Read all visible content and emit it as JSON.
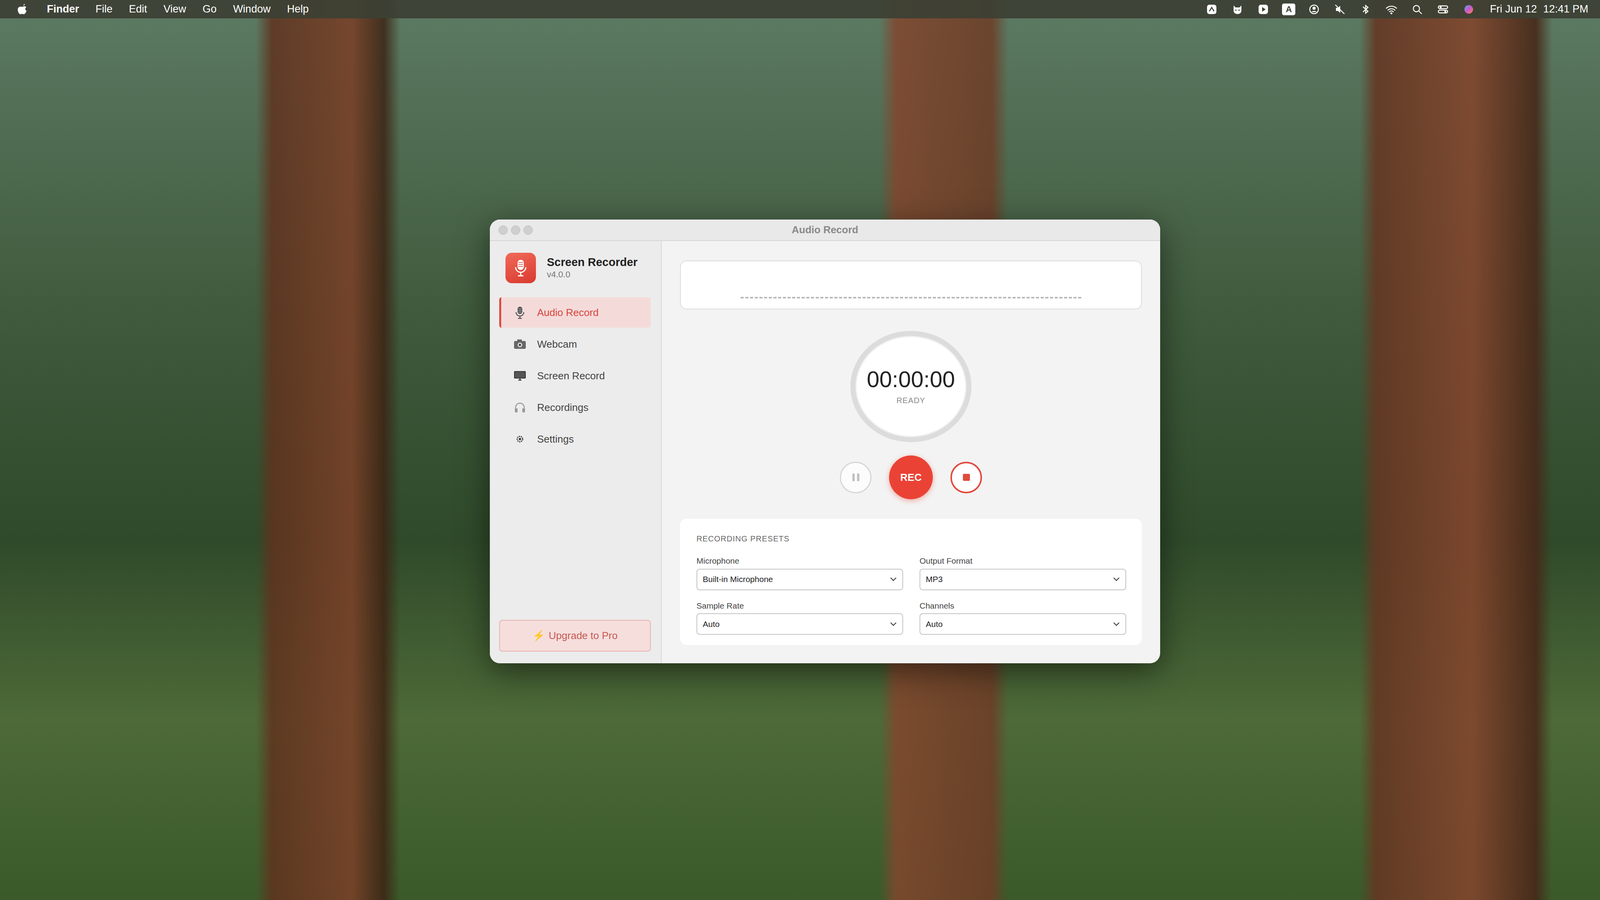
{
  "menu_bar": {
    "app": "Finder",
    "menus": [
      "File",
      "Edit",
      "View",
      "Go",
      "Window",
      "Help"
    ],
    "input_source": "A",
    "date": "Fri Jun 12",
    "time": "12:41 PM"
  },
  "window": {
    "title": "Audio Record"
  },
  "app": {
    "name": "Screen Recorder",
    "version": "v4.0.0"
  },
  "sidebar": {
    "items": [
      {
        "label": "Audio Record",
        "selected": true
      },
      {
        "label": "Webcam",
        "selected": false
      },
      {
        "label": "Screen Record",
        "selected": false
      },
      {
        "label": "Recordings",
        "selected": false
      },
      {
        "label": "Settings",
        "selected": false
      }
    ],
    "upgrade": {
      "icon": "⚡",
      "label": "Upgrade to Pro"
    }
  },
  "recorder": {
    "time": "00:00:00",
    "status": "READY",
    "rec_label": "REC",
    "pause_disabled": true,
    "stop_disabled": false
  },
  "presets": {
    "title": "RECORDING PRESETS",
    "fields": [
      {
        "label": "Microphone",
        "value": "Built-in Microphone"
      },
      {
        "label": "Output Format",
        "value": "MP3"
      },
      {
        "label": "Sample Rate",
        "value": "Auto"
      },
      {
        "label": "Channels",
        "value": "Auto"
      }
    ]
  }
}
